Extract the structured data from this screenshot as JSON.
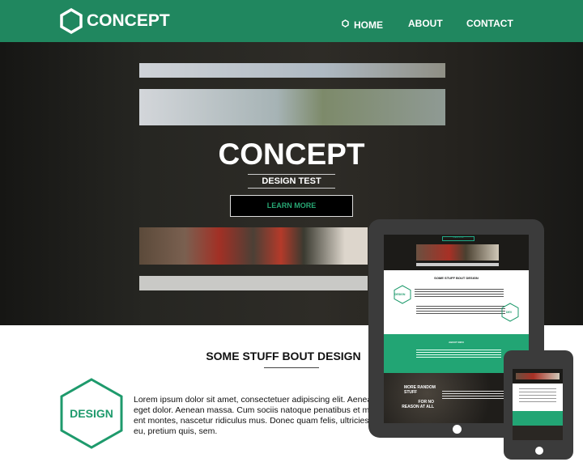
{
  "header": {
    "logo_text": "CONCEPT",
    "nav": [
      {
        "label": "HOME",
        "active": true
      },
      {
        "label": "ABOUT"
      },
      {
        "label": "CONTACT"
      }
    ]
  },
  "hero": {
    "title": "CONCEPT",
    "subtitle": "DESIGN TEST",
    "cta": "LEARN MORE"
  },
  "section": {
    "title": "SOME STUFF BOUT DESIGN",
    "badge": "DESIGN",
    "lines": [
      "Lorem ipsum dolor sit amet, consectetuer adipiscing elit. Aenean commodo ligula",
      "eget dolor. Aenean massa. Cum sociis natoque penatibus et magnis dis partur",
      "ent montes, nascetur ridiculus mus. Donec quam felis, ultricies nec, pellentesque",
      "eu, pretium quis, sem."
    ]
  },
  "tablet": {
    "cta": "LEARN MORE",
    "title": "SOME STUFF BOUT DESIGN",
    "badge1": "DESIGN",
    "badge2": "DEV",
    "about": "ABOUT INFO",
    "more1": "MORE RANDOM STUFF",
    "more2": "FOR NO REASON AT ALL"
  },
  "colors": {
    "brand": "#20875f",
    "accent": "#27a874"
  }
}
